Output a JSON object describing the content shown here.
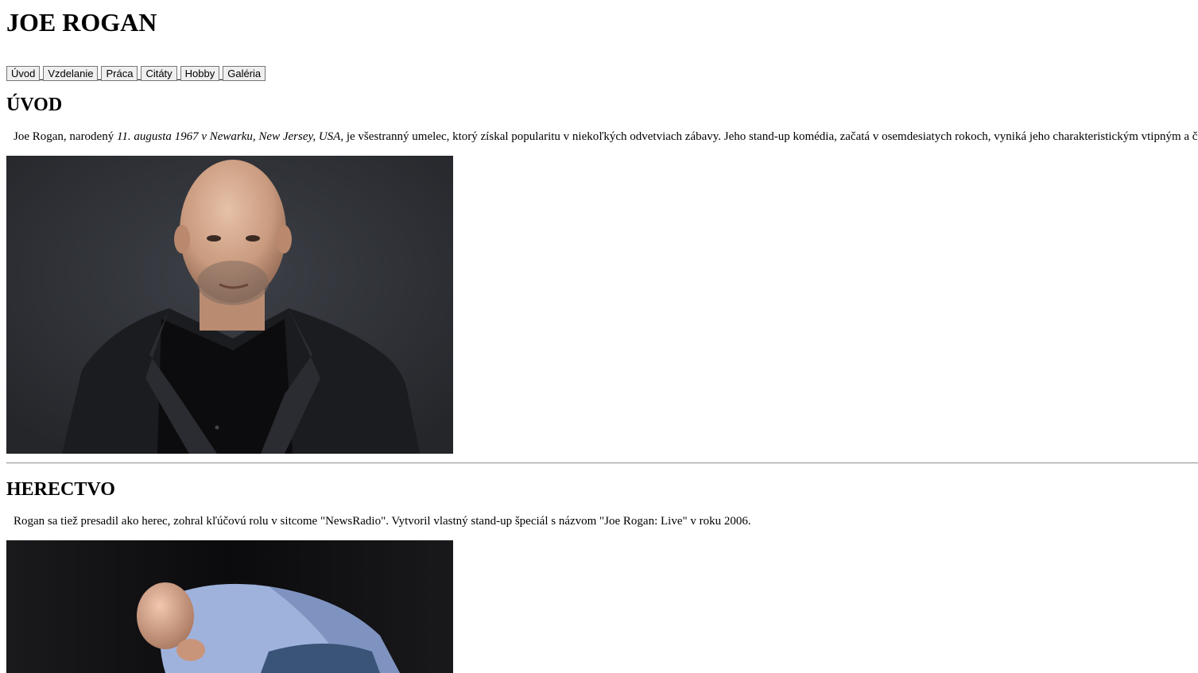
{
  "header": {
    "title": "JOE ROGAN"
  },
  "nav": {
    "items": [
      "Úvod",
      "Vzdelanie",
      "Práca",
      "Citáty",
      "Hobby",
      "Galéria"
    ]
  },
  "intro": {
    "heading": "ÚVOD",
    "text_before": "Joe Rogan, narodený ",
    "text_italic": "11. augusta 1967 v Newarku, New Jersey, USA,",
    "text_after": " je všestranný umelec, ktorý získal popularitu v niekoľkých odvetviach zábavy. Jeho stand-up komédia, začatá v osemdesiatych rokoch, vyniká jeho charakteristickým vtipným a č"
  },
  "acting": {
    "heading": "HERECTVO",
    "text": "Rogan sa tiež presadil ako herec, zohral kľúčovú rolu v sitcome \"NewsRadio\". Vytvoril vlastný stand-up špeciál s názvom \"Joe Rogan: Live\" v roku 2006."
  },
  "colors": {
    "portrait_background": "#2c2e33",
    "stage_background": "#0c0c0e",
    "shirt_blue": "#9fb2dc"
  }
}
